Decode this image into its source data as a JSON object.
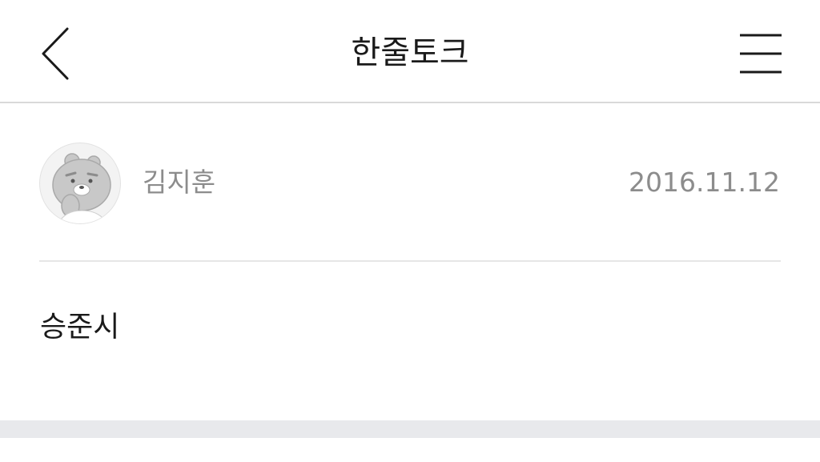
{
  "header": {
    "title": "한줄토크",
    "back_icon": "chevron-left-icon",
    "menu_icon": "hamburger-menu-icon"
  },
  "post": {
    "author": "김지훈",
    "date": "2016.11.12",
    "content": "승준시",
    "avatar_icon": "bear-character-avatar"
  },
  "colors": {
    "background": "#ffffff",
    "text_primary": "#1a1a1a",
    "text_secondary": "#8c8c8c",
    "divider": "#e6e6e6",
    "footer_band": "#e8e9ec"
  }
}
